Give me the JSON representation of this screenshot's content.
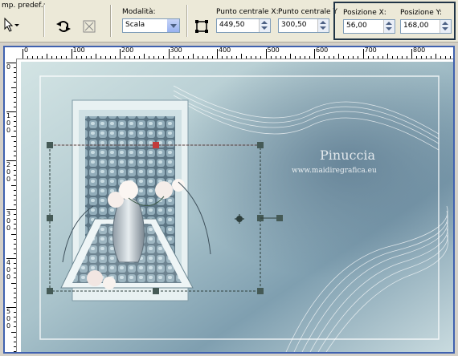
{
  "toolbar": {
    "preset_label": "mp. predef.:",
    "mode_label": "Modalità:",
    "mode_value": "Scala",
    "center_x_label": "Punto centrale X:",
    "center_x_value": "449,50",
    "center_y_label": "Punto centrale Y",
    "center_y_value": "300,50",
    "pos_x_label": "Posizione X:",
    "pos_x_value": "56,00",
    "pos_y_label": "Posizione Y:",
    "pos_y_value": "168,00"
  },
  "ruler": {
    "h_labels": [
      "0",
      "100",
      "200",
      "300",
      "400",
      "500",
      "600",
      "700",
      "800"
    ],
    "v_labels": [
      "0",
      "100",
      "200",
      "300",
      "400",
      "500"
    ]
  },
  "canvas": {
    "watermark_name": "Pinuccia",
    "watermark_url": "www.maidiregrafica.eu"
  },
  "colors": {
    "accent": "#4062b0",
    "handle": "#455a56",
    "canvas_bg": "#bcd0d4"
  },
  "icons": {
    "pointer": "pointer-icon",
    "rotate": "rotate-icon",
    "flip": "flip-icon",
    "center": "center-icon"
  }
}
